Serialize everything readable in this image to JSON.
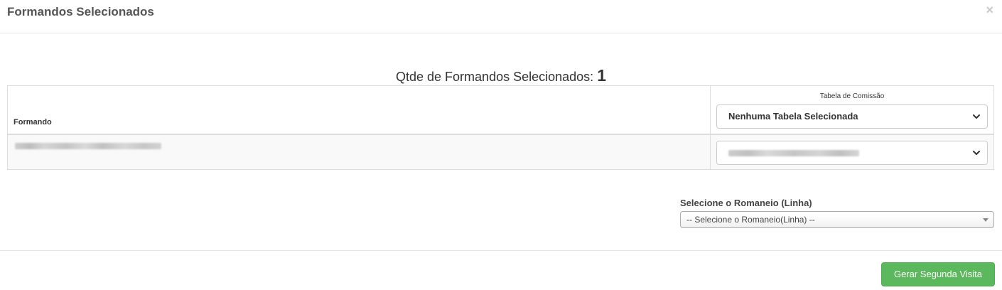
{
  "modal": {
    "title": "Formandos Selecionados",
    "close_glyph": "×"
  },
  "summary": {
    "label": "Qtde de Formandos Selecionados:",
    "count": "1"
  },
  "table": {
    "columns": {
      "formando": "Formando",
      "tabela_comissao": "Tabela de Comissão"
    },
    "header_select_value": "Nenhuma Tabela Selecionada",
    "rows": [
      {
        "formando": "",
        "tabela": ""
      }
    ]
  },
  "romaneio": {
    "label": "Selecione o Romaneio (Linha)",
    "placeholder": "-- Selecione o Romaneio(Linha) --"
  },
  "footer": {
    "submit_label": "Gerar Segunda Visita"
  },
  "icons": {
    "close": "close-icon",
    "select_chevron": "chevron-down-icon",
    "dropdown_arrow": "caret-down-icon"
  },
  "colors": {
    "primary_success": "#5cb85c",
    "border": "#dddddd",
    "text": "#333333"
  }
}
